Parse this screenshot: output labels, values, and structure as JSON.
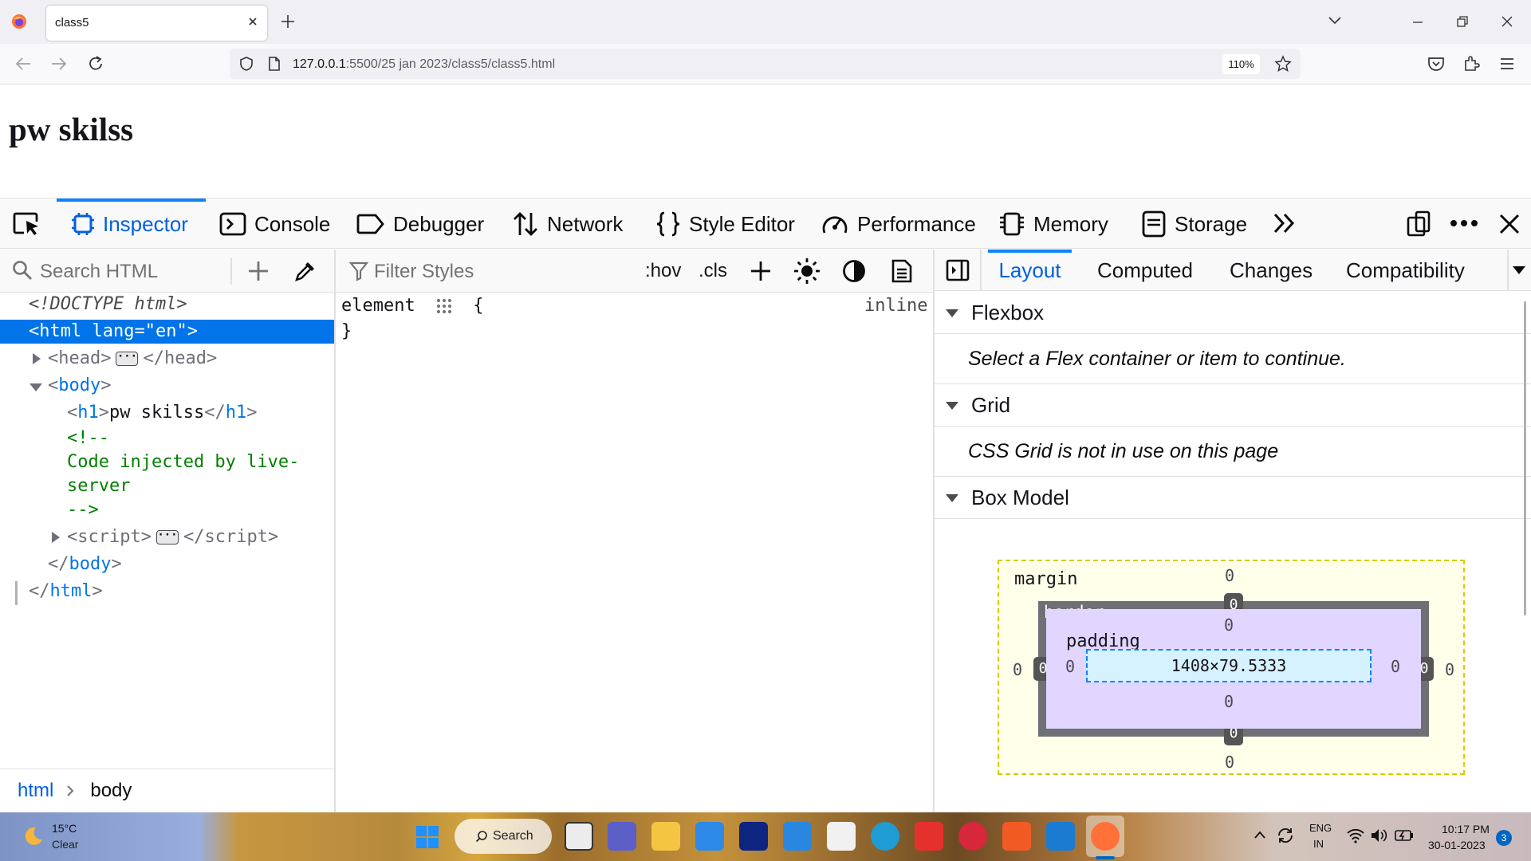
{
  "browser": {
    "tab_title": "class5",
    "url_host": "127.0.0.1",
    "url_rest": ":5500/25 jan 2023/class5/class5.html",
    "zoom": "110%"
  },
  "page": {
    "heading": "pw skilss"
  },
  "devtools": {
    "tabs": [
      "Inspector",
      "Console",
      "Debugger",
      "Network",
      "Style Editor",
      "Performance",
      "Memory",
      "Storage"
    ],
    "search_html_placeholder": "Search HTML",
    "filter_styles_placeholder": "Filter Styles",
    "hov": ":hov",
    "cls": ".cls",
    "markup": {
      "doctype": "<!DOCTYPE html>",
      "html_open_tag": "html",
      "html_attr_name": "lang",
      "html_attr_value": "\"en\"",
      "head": "head",
      "body": "body",
      "h1": "h1",
      "h1_text": "pw skilss",
      "comment_open": "<!--",
      "comment_line1": "Code injected by live-",
      "comment_line2": "server",
      "comment_close": "-->",
      "script": "script",
      "html_close": "html"
    },
    "breadcrumbs": [
      "html",
      "body"
    ],
    "rules": {
      "selector": "element",
      "open_brace": "{",
      "close_brace": "}",
      "source": "inline"
    },
    "layout_tabs": [
      "Layout",
      "Computed",
      "Changes",
      "Compatibility"
    ],
    "flexbox": {
      "title": "Flexbox",
      "message": "Select a Flex container or item to continue."
    },
    "grid": {
      "title": "Grid",
      "message": "CSS Grid is not in use on this page"
    },
    "box_model": {
      "title": "Box Model",
      "margin_label": "margin",
      "border_label": "border",
      "padding_label": "padding",
      "margin": {
        "top": "0",
        "right": "0",
        "bottom": "0",
        "left": "0"
      },
      "border": {
        "top": "0",
        "right": "0",
        "bottom": "0",
        "left": "0"
      },
      "padding": {
        "top": "0",
        "right": "0",
        "bottom": "0",
        "left": "0"
      },
      "content": "1408×79.5333"
    }
  },
  "taskbar": {
    "temperature": "15°C",
    "weather": "Clear",
    "search_label": "Search",
    "language": "ENG",
    "region": "IN",
    "time": "10:17 PM",
    "date": "30-01-2023",
    "notification_count": "3"
  },
  "colors": {
    "accent": "#0a84ff",
    "selected_row": "#0074e8"
  }
}
